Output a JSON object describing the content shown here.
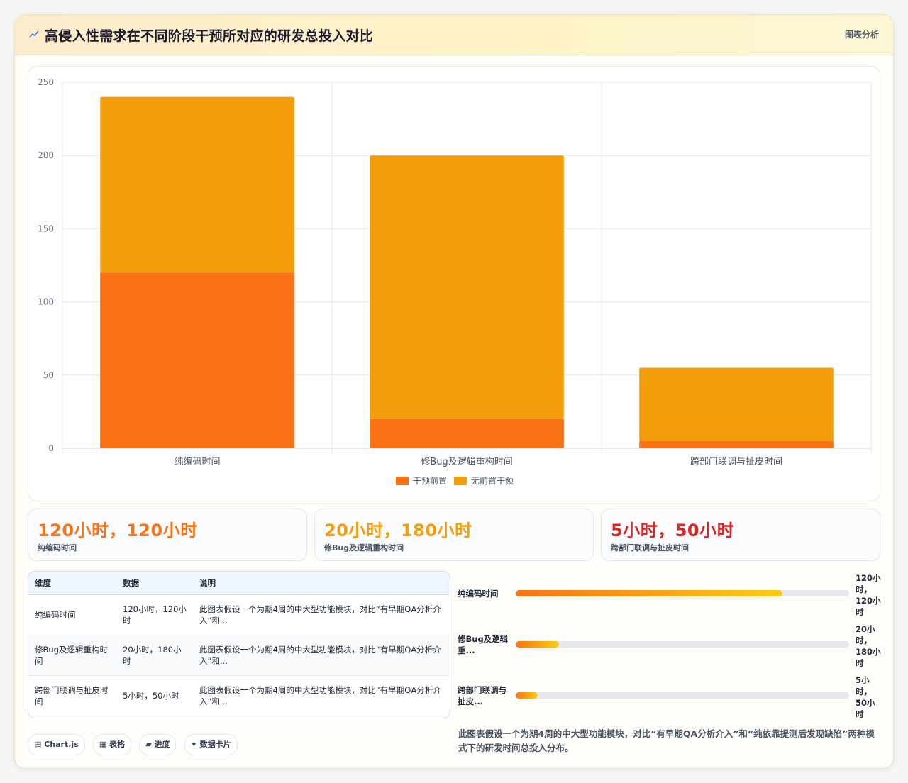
{
  "header": {
    "title": "高侵入性需求在不同阶段干预所对应的研发总投入对比",
    "action": "图表分析"
  },
  "colors": {
    "intervention": "#f97316",
    "no_intervention": "#f59e0b",
    "stat_1": "#f97316",
    "stat_2": "#f59e0b",
    "stat_3": "#dc2626"
  },
  "chart_data": {
    "type": "bar",
    "stacked": true,
    "categories": [
      "纯编码时间",
      "修Bug及逻辑重构时间",
      "跨部门联调与扯皮时间"
    ],
    "series": [
      {
        "name": "干预前置",
        "values": [
          120,
          20,
          5
        ]
      },
      {
        "name": "无前置干预",
        "values": [
          120,
          180,
          50
        ]
      }
    ],
    "ylim": [
      0,
      250
    ],
    "yticks": [
      "0",
      "50",
      "100",
      "150",
      "200",
      "250"
    ],
    "grid": true,
    "legend": "bottom"
  },
  "stats": [
    {
      "value": "120小时，120小时",
      "label": "纯编码时间"
    },
    {
      "value": "20小时，180小时",
      "label": "修Bug及逻辑重构时间"
    },
    {
      "value": "5小时，50小时",
      "label": "跨部门联调与扯皮时间"
    }
  ],
  "table": {
    "headers": [
      "维度",
      "数据",
      "说明"
    ],
    "rows": [
      {
        "dim": "纯编码时间",
        "data": "120小时，120小时",
        "desc": "此图表假设一个为期4周的中大型功能模块，对比“有早期QA分析介入”和..."
      },
      {
        "dim": "修Bug及逻辑重构时间",
        "data": "20小时，180小时",
        "desc": "此图表假设一个为期4周的中大型功能模块，对比“有早期QA分析介入”和..."
      },
      {
        "dim": "跨部门联调与扯皮时间",
        "data": "5小时，50小时",
        "desc": "此图表假设一个为期4周的中大型功能模块，对比“有早期QA分析介入”和..."
      }
    ]
  },
  "progress": [
    {
      "label": "纯编码时间",
      "value": "120小时，120小时",
      "fraction": 0.8
    },
    {
      "label": "修Bug及逻辑重...",
      "value": "20小时，180小时",
      "fraction": 0.13
    },
    {
      "label": "跨部门联调与扯皮...",
      "value": "5小时，50小时",
      "fraction": 0.065
    }
  ],
  "note": "此图表假设一个为期4周的中大型功能模块，对比“有早期QA分析介入”和“纯依靠提测后发现缺陷”两种模式下的研发时间总投入分布。",
  "tags": [
    {
      "label": "Chart.js",
      "icon": "chart-icon"
    },
    {
      "label": "表格",
      "icon": "table-icon"
    },
    {
      "label": "进度",
      "icon": "progress-icon"
    },
    {
      "label": "数据卡片",
      "icon": "sparkle-icon"
    }
  ]
}
